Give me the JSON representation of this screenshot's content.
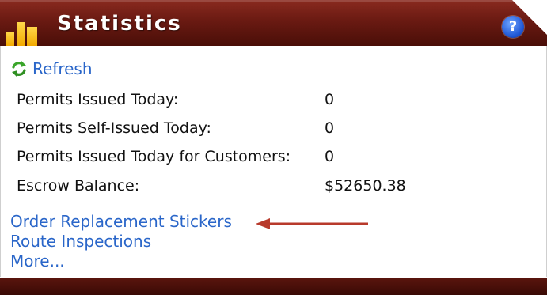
{
  "header": {
    "title": "Statistics",
    "help_label": "?"
  },
  "refresh": {
    "label": "Refresh",
    "icon": "refresh-icon"
  },
  "stats": [
    {
      "label": "Permits Issued Today:",
      "value": "0"
    },
    {
      "label": "Permits Self-Issued Today:",
      "value": "0"
    },
    {
      "label": "Permits Issued Today for Customers:",
      "value": "0"
    },
    {
      "label": "Escrow Balance:",
      "value": "$52650.38"
    }
  ],
  "links": [
    {
      "label": "Order Replacement Stickers"
    },
    {
      "label": "Route Inspections"
    },
    {
      "label": "More..."
    }
  ],
  "colors": {
    "header_dark": "#4a0e08",
    "header_light": "#8a2a1f",
    "link": "#2a66c9",
    "arrow": "#b83a2b",
    "icon_gold": "#f2a900",
    "help_blue": "#1f57d6",
    "refresh_green": "#3aa52a"
  }
}
